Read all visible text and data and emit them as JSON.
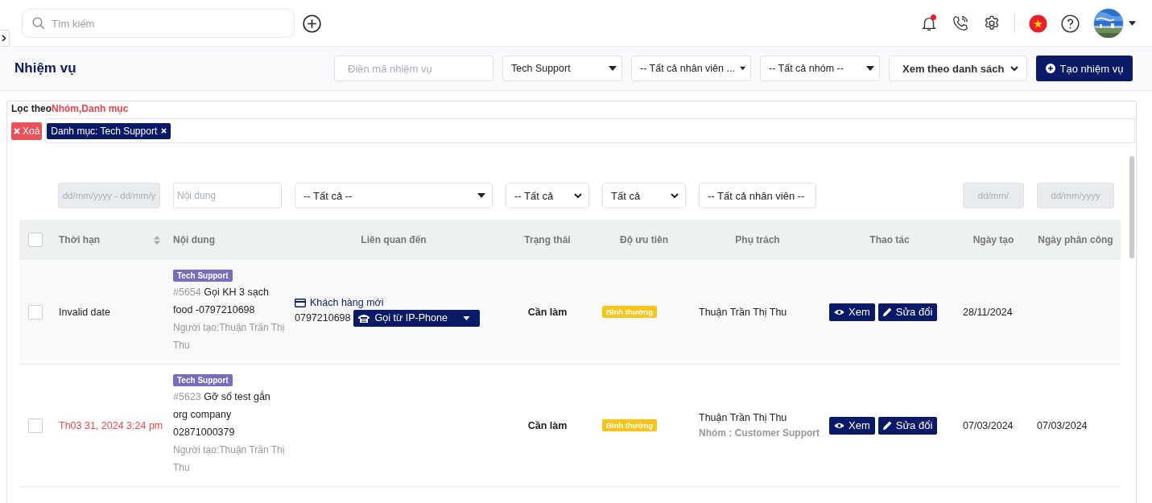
{
  "topbar": {
    "search": {
      "placeholder": "Tìm kiếm"
    },
    "notifications": {
      "unread": true
    }
  },
  "header": {
    "title": "Nhiệm vụ",
    "code_field": {
      "placeholder": "Điền mã nhiệm vụ"
    },
    "filters": [
      {
        "kind": "dropdown",
        "value": "Tech Support"
      },
      {
        "kind": "dropdown",
        "value": "-- Tất cả nhân viên ..."
      },
      {
        "kind": "dropdown",
        "value": "-- Tất cả nhóm --"
      },
      {
        "kind": "select",
        "value": "Xem theo danh sách"
      }
    ],
    "create_button": "Tạo nhiệm vụ"
  },
  "filter_summary": {
    "label": "Lọc theo",
    "fields": "Nhóm,Danh mục",
    "clear_button": "Xoá",
    "chips": [
      {
        "label": "Danh mục: Tech Support"
      }
    ]
  },
  "table": {
    "select_all": {
      "checked": false
    },
    "columns": [
      {
        "label": "Thời hạn",
        "sortable": true,
        "filter": {
          "kind": "date",
          "placeholder": "dd/mm/yyyy - dd/mm/y"
        }
      },
      {
        "label": "Nội dung",
        "sortable": false,
        "filter": {
          "kind": "text",
          "placeholder": "Nội dung"
        }
      },
      {
        "label": "Liên quan đến",
        "sortable": false,
        "filter": {
          "kind": "dropdown",
          "value": "-- Tất cả --"
        }
      },
      {
        "label": "Trạng thái",
        "sortable": false,
        "filter": {
          "kind": "select",
          "value": "-- Tất cả"
        }
      },
      {
        "label": "Độ ưu tiên",
        "sortable": false,
        "filter": {
          "kind": "select",
          "value": "Tất cả"
        }
      },
      {
        "label": "Phụ trách",
        "sortable": false,
        "filter": {
          "kind": "dropdown",
          "value": "-- Tất cả nhân viên --"
        }
      },
      {
        "label": "Thao tác",
        "sortable": false
      },
      {
        "label": "Ngày tạo",
        "sortable": false,
        "filter": {
          "kind": "date",
          "placeholder": "dd/mm/"
        }
      },
      {
        "label": "Ngày phân công",
        "sortable": false,
        "filter": {
          "kind": "date",
          "placeholder": "dd/mm/yyyy"
        }
      }
    ],
    "rows": [
      {
        "selected": false,
        "deadline": {
          "text": "Invalid date",
          "overdue": false
        },
        "category": "Tech Support",
        "id": "#5654",
        "title": "Gọi KH 3 sạch food -0797210698",
        "creator": "Người tạo:Thuận Trần Thị Thu",
        "related": {
          "customer": "Khách hàng mới",
          "phone": "0797210698",
          "call_button": "Gọi từ IP-Phone"
        },
        "status": "Cần làm",
        "priority": "Bình thường",
        "assignee": "Thuận Trần Thị Thu",
        "actions": [
          "Xem",
          "Sửa đổi"
        ],
        "created": "28/11/2024"
      },
      {
        "selected": false,
        "deadline": {
          "text": "Th03 31, 2024 3:24 pm",
          "overdue": true
        },
        "category": "Tech Support",
        "id": "#5623",
        "title": "Gỡ số test gắn org company 02871000379",
        "creator": "Người tạo:Thuận Trần Thị Thu",
        "status": "Cần làm",
        "priority": "Bình thường",
        "assignee": "Thuận Trần Thị Thu",
        "group": "Nhóm : Customer Support",
        "actions": [
          "Xem",
          "Sửa đổi"
        ],
        "created": "07/03/2024",
        "assigned": "07/03/2024"
      }
    ]
  }
}
